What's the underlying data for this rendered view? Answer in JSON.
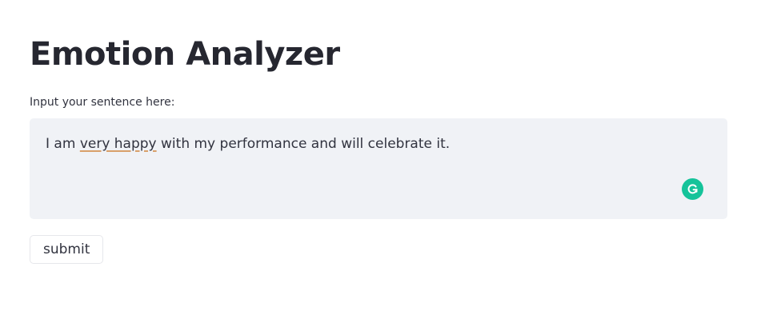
{
  "app": {
    "title": "Emotion Analyzer"
  },
  "form": {
    "input_label": "Input your sentence here:",
    "textarea": {
      "before": "I am ",
      "flagged": "very happy",
      "after": " with my performance and will celebrate it."
    },
    "submit_label": "submit"
  },
  "icons": {
    "grammarly": "grammarly-g-icon"
  },
  "colors": {
    "grammarly": "#15c39a",
    "textarea_bg": "#f0f2f6",
    "text": "#31333f"
  }
}
